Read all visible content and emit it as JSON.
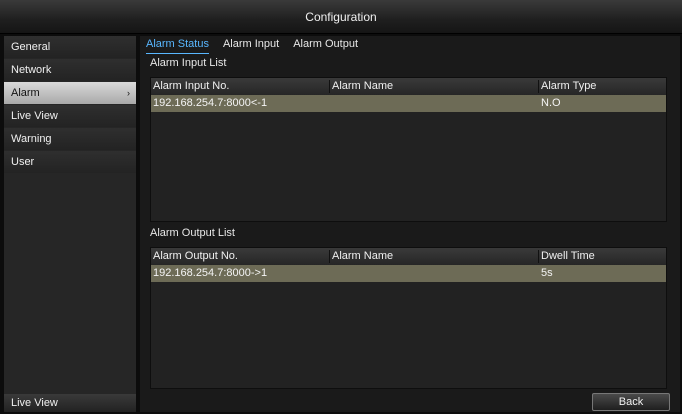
{
  "window": {
    "title": "Configuration"
  },
  "sidebar": {
    "items": [
      {
        "label": "General"
      },
      {
        "label": "Network"
      },
      {
        "label": "Alarm",
        "active": true,
        "arrow": "›"
      },
      {
        "label": "Live View"
      },
      {
        "label": "Warning"
      },
      {
        "label": "User"
      }
    ],
    "bottom_label": "Live View"
  },
  "tabs": [
    {
      "label": "Alarm Status",
      "active": true
    },
    {
      "label": "Alarm Input"
    },
    {
      "label": "Alarm Output"
    }
  ],
  "alarm_input": {
    "title": "Alarm Input List",
    "columns": [
      "Alarm Input No.",
      "Alarm Name",
      "Alarm Type"
    ],
    "rows": [
      [
        "192.168.254.7:8000<-1",
        "",
        "N.O"
      ]
    ]
  },
  "alarm_output": {
    "title": "Alarm Output List",
    "columns": [
      "Alarm Output No.",
      "Alarm Name",
      "Dwell Time"
    ],
    "rows": [
      [
        "192.168.254.7:8000->1",
        "",
        "5s"
      ]
    ]
  },
  "buttons": {
    "back": "Back"
  },
  "colors": {
    "accent": "#59b7ff",
    "row_highlight": "#6d6b56"
  }
}
